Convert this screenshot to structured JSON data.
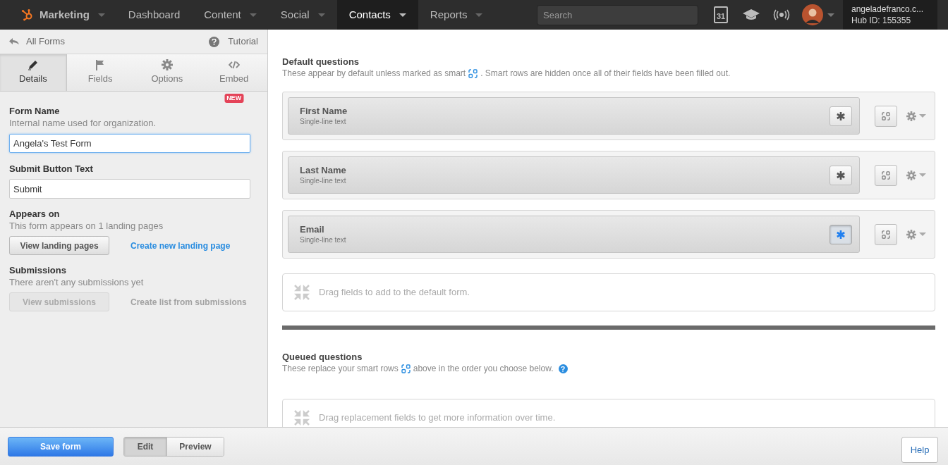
{
  "nav": {
    "brand": "Marketing",
    "items": [
      {
        "label": "Dashboard",
        "caret": false,
        "selected": false
      },
      {
        "label": "Content",
        "caret": true,
        "selected": false
      },
      {
        "label": "Social",
        "caret": true,
        "selected": false
      },
      {
        "label": "Contacts",
        "caret": true,
        "selected": true
      },
      {
        "label": "Reports",
        "caret": true,
        "selected": false
      }
    ],
    "search": {
      "placeholder": "Search"
    },
    "calendar_day": "31",
    "account": {
      "email": "angeladefranco.c...",
      "hub_id": "Hub ID: 155355"
    }
  },
  "sidebar": {
    "back": "All Forms",
    "tutorial": "Tutorial",
    "tabs": [
      {
        "label": "Details",
        "kind": "pencil",
        "selected": true
      },
      {
        "label": "Fields",
        "kind": "flag",
        "selected": false
      },
      {
        "label": "Options",
        "kind": "gear",
        "selected": false
      },
      {
        "label": "Embed",
        "kind": "code",
        "selected": false,
        "badge": "NEW"
      }
    ],
    "form_name": {
      "label": "Form Name",
      "hint": "Internal name used for organization.",
      "value": "Angela's Test Form"
    },
    "submit_text": {
      "label": "Submit Button Text",
      "value": "Submit"
    },
    "appears_on": {
      "label": "Appears on",
      "text": "This form appears on 1 landing pages",
      "button": {
        "label": "View landing pages",
        "disabled": false
      },
      "link": {
        "label": "Create new landing page",
        "disabled": false
      }
    },
    "submissions": {
      "label": "Submissions",
      "text": "There aren't any submissions yet",
      "button": {
        "label": "View submissions",
        "disabled": true
      },
      "link": {
        "label": "Create list from submissions",
        "disabled": true
      }
    }
  },
  "default_questions": {
    "title": "Default questions",
    "text_before": "These appear by default unless marked as smart",
    "text_after": ". Smart rows are hidden once all of their fields have been filled out.",
    "fields": [
      {
        "label": "First Name",
        "type": "Single-line text",
        "required_on": false
      },
      {
        "label": "Last Name",
        "type": "Single-line text",
        "required_on": false
      },
      {
        "label": "Email",
        "type": "Single-line text",
        "required_on": true
      }
    ],
    "drop_hint": "Drag fields to add to the default form."
  },
  "queued_questions": {
    "title": "Queued questions",
    "text_before": "These replace your smart rows",
    "text_after": "above in the order you choose below.",
    "drop_hint": "Drag replacement fields to get more information over time."
  },
  "footer": {
    "save": "Save form",
    "modes": [
      {
        "label": "Edit",
        "selected": true
      },
      {
        "label": "Preview",
        "selected": false
      }
    ],
    "help": "Help"
  }
}
